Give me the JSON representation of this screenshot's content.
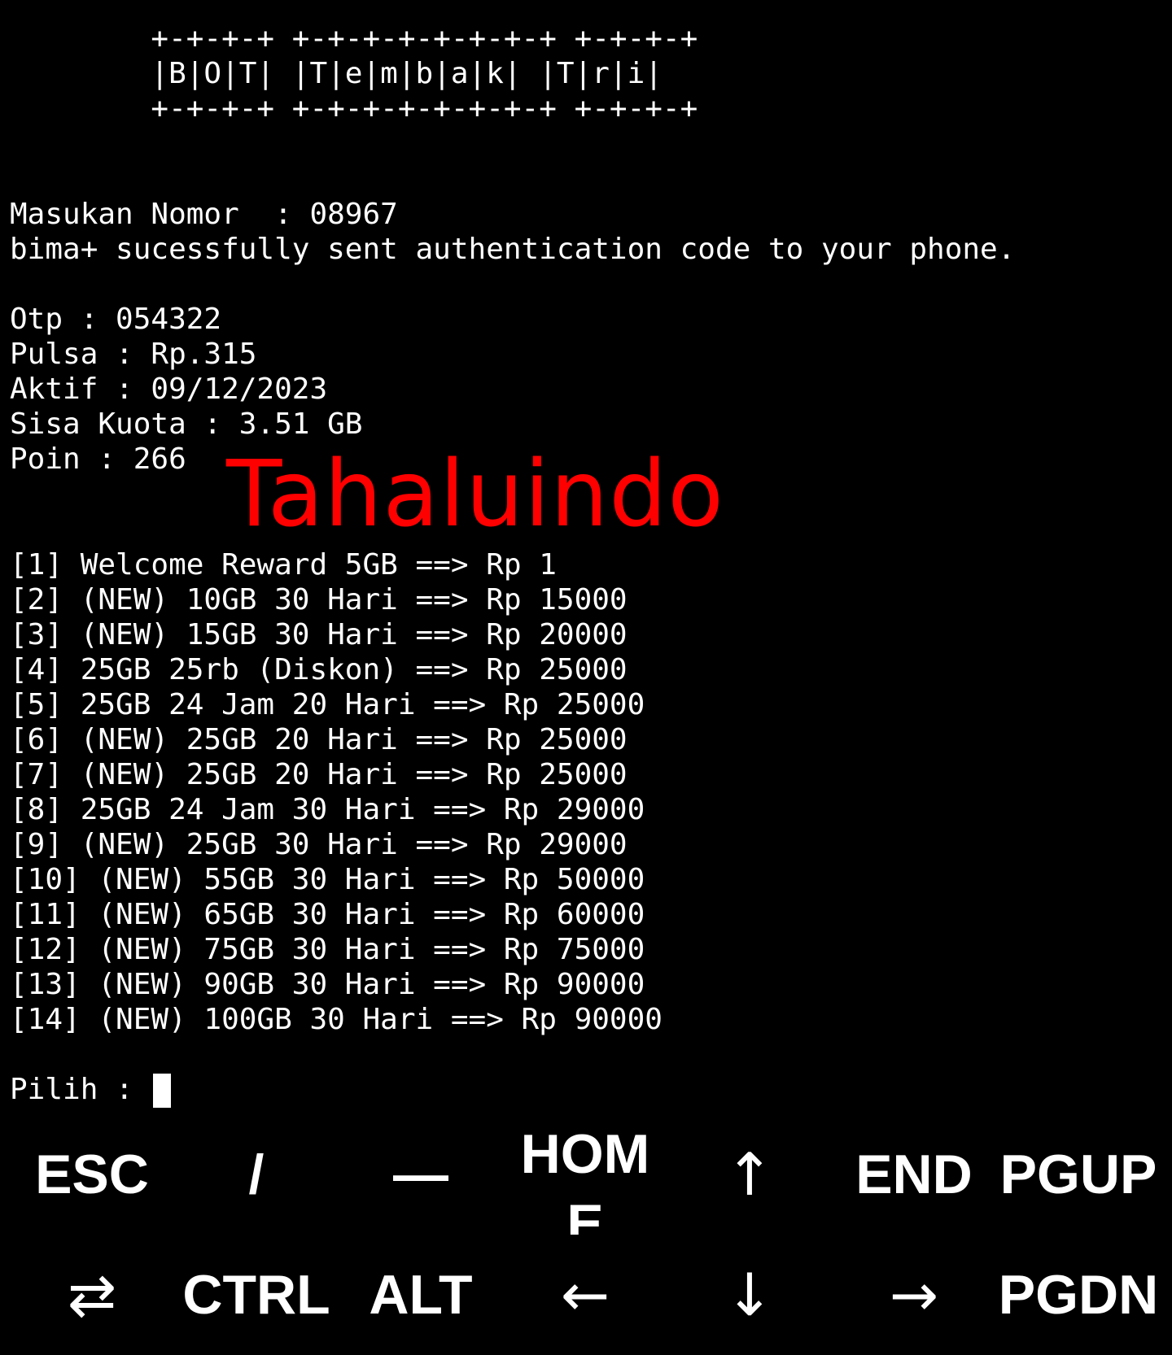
{
  "terminal": {
    "banner": [
      "        +-+-+-+ +-+-+-+-+-+-+-+ +-+-+-+",
      "        |B|O|T| |T|e|m|b|a|k| |T|r|i|",
      "        +-+-+-+ +-+-+-+-+-+-+-+ +-+-+-+"
    ],
    "nomor_line": "Masukan Nomor  : 08967",
    "sent_message": "bima+ sucessfully sent authentication code to your phone.",
    "otp_line": "Otp : 054322",
    "pulsa_line": "Pulsa : Rp.315",
    "aktif_line": "Aktif : 09/12/2023",
    "kuota_line": "Sisa Kuota : 3.51 GB",
    "poin_line": "Poin : 266",
    "menu": [
      "[1] Welcome Reward 5GB ==> Rp 1",
      "[2] (NEW) 10GB 30 Hari ==> Rp 15000",
      "[3] (NEW) 15GB 30 Hari ==> Rp 20000",
      "[4] 25GB 25rb (Diskon) ==> Rp 25000",
      "[5] 25GB 24 Jam 20 Hari ==> Rp 25000",
      "[6] (NEW) 25GB 20 Hari ==> Rp 25000",
      "[7] (NEW) 25GB 20 Hari ==> Rp 25000",
      "[8] 25GB 24 Jam 30 Hari ==> Rp 29000",
      "[9] (NEW) 25GB 30 Hari ==> Rp 29000",
      "[10] (NEW) 55GB 30 Hari ==> Rp 50000",
      "[11] (NEW) 65GB 30 Hari ==> Rp 60000",
      "[12] (NEW) 75GB 30 Hari ==> Rp 75000",
      "[13] (NEW) 90GB 30 Hari ==> Rp 90000",
      "[14] (NEW) 100GB 30 Hari ==> Rp 90000"
    ],
    "prompt": "Pilih : "
  },
  "watermark": {
    "text": "Tahaluindo",
    "color": "#ff0000"
  },
  "extra_keys": {
    "row1": [
      "ESC",
      "/",
      "—",
      "HOME",
      "↑",
      "END",
      "PGUP"
    ],
    "row2": [
      "⇄",
      "CTRL",
      "ALT",
      "←",
      "↓",
      "→",
      "PGDN"
    ]
  },
  "colors": {
    "background": "#000000",
    "text": "#ffffff"
  }
}
